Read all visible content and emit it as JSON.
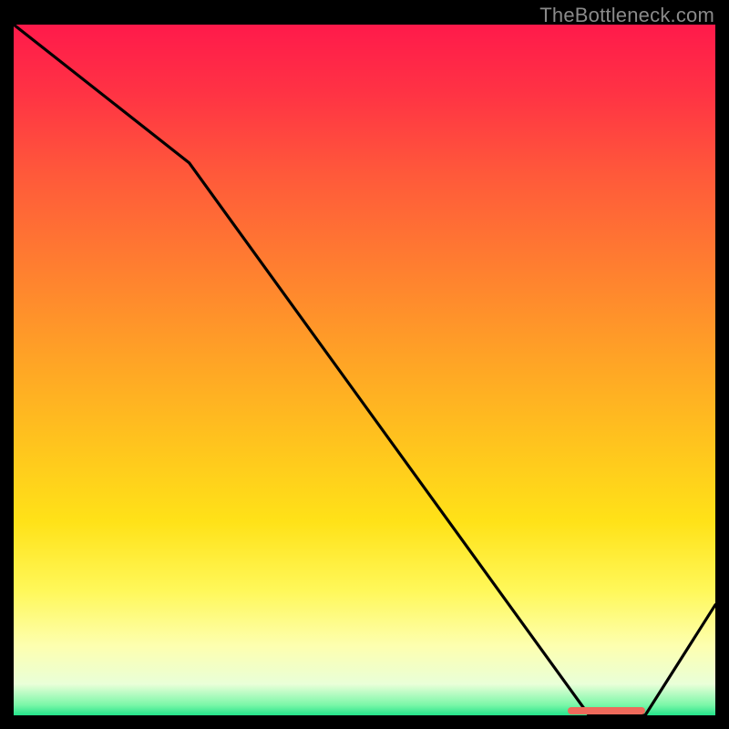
{
  "attribution": "TheBottleneck.com",
  "colors": {
    "bg": "#000000",
    "line": "#000000",
    "marker": "#ee6a5b",
    "gradient_stops": [
      {
        "offset": 0.0,
        "color": "#ff1a4b"
      },
      {
        "offset": 0.1,
        "color": "#ff3344"
      },
      {
        "offset": 0.22,
        "color": "#ff5a3a"
      },
      {
        "offset": 0.35,
        "color": "#ff7e30"
      },
      {
        "offset": 0.48,
        "color": "#ffa226"
      },
      {
        "offset": 0.6,
        "color": "#ffc21e"
      },
      {
        "offset": 0.72,
        "color": "#ffe218"
      },
      {
        "offset": 0.82,
        "color": "#fff85a"
      },
      {
        "offset": 0.9,
        "color": "#fdffb0"
      },
      {
        "offset": 0.955,
        "color": "#e9ffd8"
      },
      {
        "offset": 0.985,
        "color": "#7bf7a8"
      },
      {
        "offset": 1.0,
        "color": "#23e38a"
      }
    ]
  },
  "chart_data": {
    "type": "line",
    "xlabel": "",
    "ylabel": "",
    "title": "",
    "xlim": [
      0,
      100
    ],
    "ylim": [
      0,
      100
    ],
    "x": [
      0,
      25,
      82,
      90,
      100
    ],
    "y": [
      100,
      80,
      0,
      0,
      16
    ],
    "marker_segment": {
      "x0": 79,
      "x1": 90,
      "y": 0.7
    }
  }
}
